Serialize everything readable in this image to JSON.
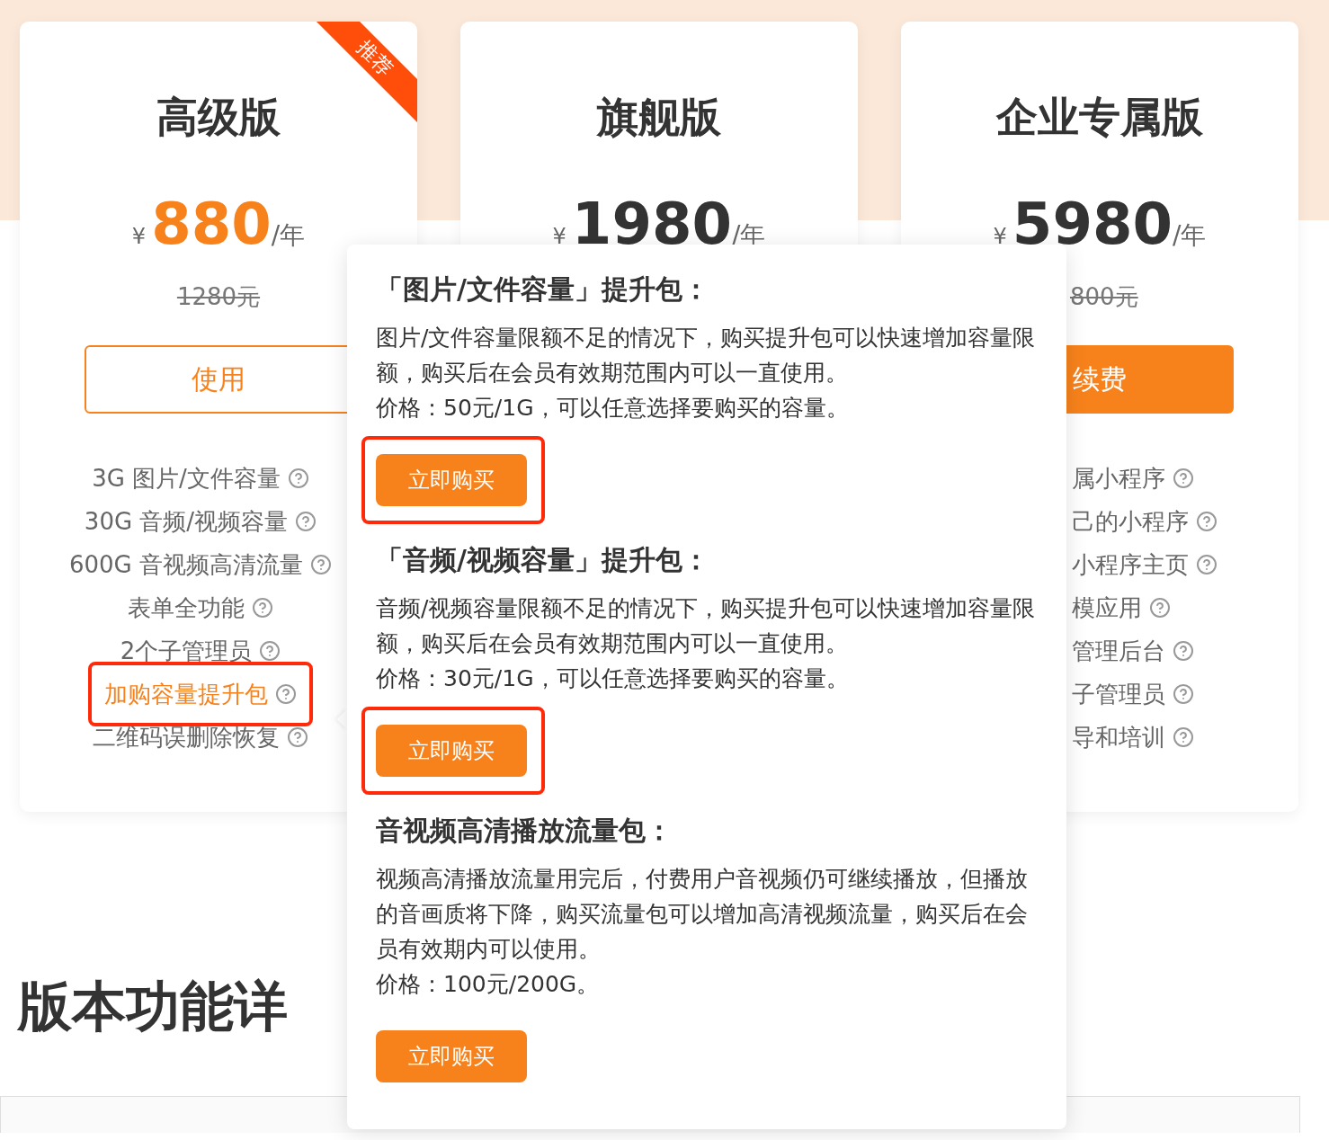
{
  "plans": [
    {
      "title": "高级版",
      "badge": "推荐",
      "currency": "¥",
      "price": "880",
      "period": "/年",
      "highlight_price": true,
      "old_price": "1280元",
      "button": {
        "label": "使用",
        "kind": "outline"
      },
      "features_clipped": false,
      "features": [
        {
          "label": "3G 图片/文件容量",
          "highlighted": false,
          "annotated": false
        },
        {
          "label": "30G 音频/视频容量",
          "highlighted": false,
          "annotated": false
        },
        {
          "label": "600G 音视频高清流量",
          "highlighted": false,
          "annotated": false
        },
        {
          "label": "表单全功能",
          "highlighted": false,
          "annotated": false
        },
        {
          "label": "2个子管理员",
          "highlighted": false,
          "annotated": false
        },
        {
          "label": "加购容量提升包",
          "highlighted": true,
          "annotated": true
        },
        {
          "label": "二维码误删除恢复",
          "highlighted": false,
          "annotated": false
        }
      ]
    },
    {
      "title": "旗舰版",
      "currency": "¥",
      "price": "1980",
      "period": "/年",
      "highlight_price": false
    },
    {
      "title": "企业专属版",
      "currency": "¥",
      "price": "5980",
      "period": "/年",
      "highlight_price": false,
      "old_price": "800元",
      "button": {
        "label": "续费",
        "kind": "filled"
      },
      "features_clipped": true,
      "features": [
        {
          "label": "属小程序",
          "highlighted": false,
          "annotated": false
        },
        {
          "label": "己的小程序",
          "highlighted": false,
          "annotated": false
        },
        {
          "label": "小程序主页",
          "highlighted": false,
          "annotated": false
        },
        {
          "label": "模应用",
          "highlighted": false,
          "annotated": false
        },
        {
          "label": "管理后台",
          "highlighted": false,
          "annotated": false
        },
        {
          "label": "子管理员",
          "highlighted": false,
          "annotated": false
        },
        {
          "label": "导和培训",
          "highlighted": false,
          "annotated": false
        }
      ]
    }
  ],
  "section_heading": "版本功能详",
  "popover": {
    "sections": [
      {
        "title": "「图片/文件容量」提升包：",
        "description": "图片/文件容量限额不足的情况下，购买提升包可以快速增加容量限额，购买后在会员有效期范围内可以一直使用。",
        "price": "价格：50元/1G，可以任意选择要购买的容量。",
        "button": "立即购买",
        "annotated": true
      },
      {
        "title": "「音频/视频容量」提升包：",
        "description": "音频/视频容量限额不足的情况下，购买提升包可以快速增加容量限额，购买后在会员有效期范围内可以一直使用。",
        "price": "价格：30元/1G，可以任意选择要购买的容量。",
        "button": "立即购买",
        "annotated": true
      },
      {
        "title": "音视频高清播放流量包：",
        "description": "视频高清播放流量用完后，付费用户音视频仍可继续播放，但播放的音画质将下降，购买流量包可以增加高清视频流量，购买后在会员有效期内可以使用。",
        "price": "价格：100元/200G。",
        "button": "立即购买",
        "annotated": false
      }
    ]
  }
}
